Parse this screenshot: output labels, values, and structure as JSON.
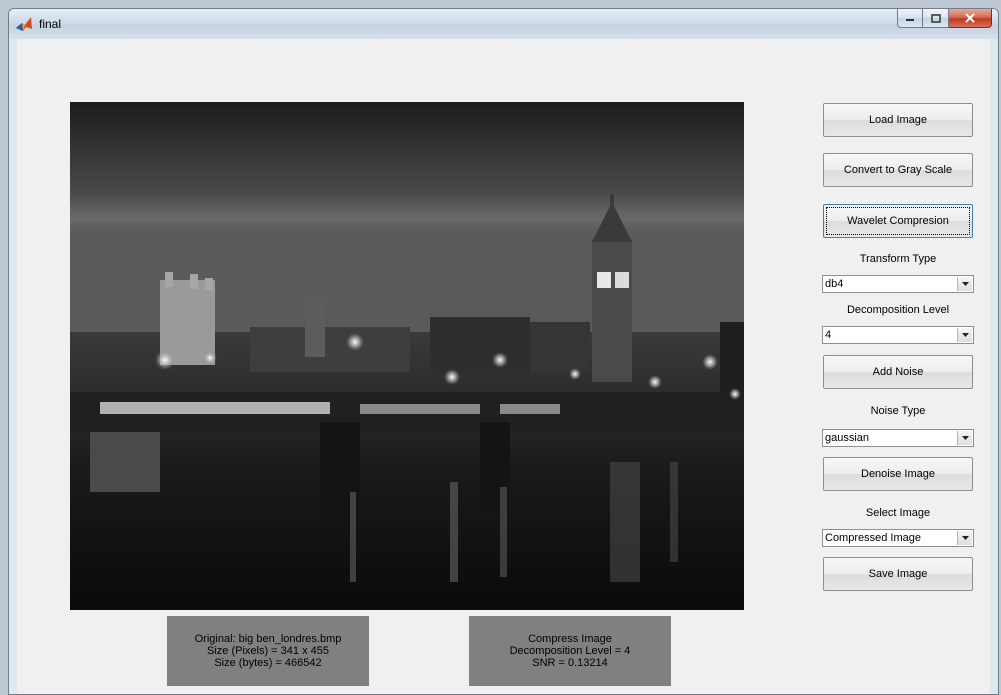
{
  "window": {
    "title": "final"
  },
  "buttons": {
    "load": "Load Image",
    "gray": "Convert to Gray Scale",
    "wavelet": "Wavelet Compresion",
    "add_noise": "Add Noise",
    "denoise": "Denoise Image",
    "save": "Save Image"
  },
  "labels": {
    "transform_type": "Transform Type",
    "decomposition_level": "Decomposition Level",
    "noise_type": "Noise Type",
    "select_image": "Select Image"
  },
  "selects": {
    "transform_type": "db4",
    "decomposition_level": "4",
    "noise_type": "gaussian",
    "select_image": "Compressed Image"
  },
  "info_original": {
    "line1": "Original:  big ben_londres.bmp",
    "line2": "Size (Pixels) = 341 x 455",
    "line3": "Size (bytes) = 466542"
  },
  "info_compress": {
    "line1": "Compress Image",
    "line2": "Decomposition Level = 4",
    "line3": "SNR =  0.13214"
  },
  "colors": {
    "client_bg": "#f0f0f0",
    "info_panel_bg": "#808080",
    "close_button": "#c0391f"
  }
}
